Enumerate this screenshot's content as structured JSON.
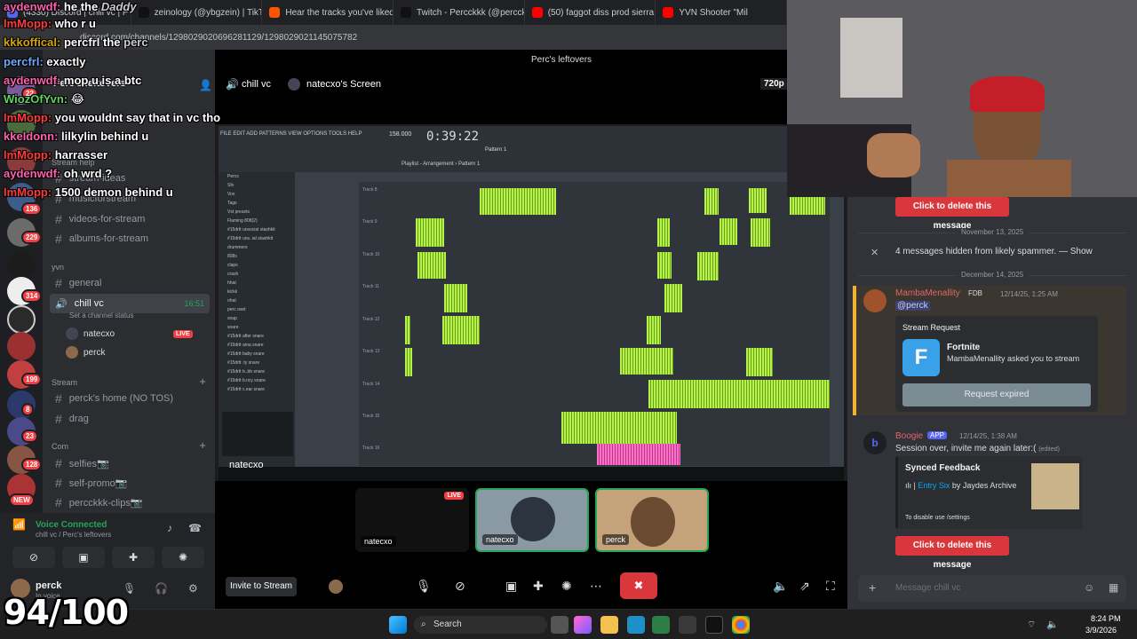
{
  "browser": {
    "tabs": [
      {
        "label": "(4330) Discord | chill vc | P",
        "color": "#5865f2"
      },
      {
        "label": "zeinology (@ybgzein) | TikTok",
        "color": "#111111"
      },
      {
        "label": "Hear the tracks you've liked: on",
        "color": "#ff5500"
      },
      {
        "label": "Twitch - Percckkk (@percckkkp",
        "color": "#111111"
      },
      {
        "label": "(50) faggot diss prod sierra by",
        "color": "#ff0000"
      },
      {
        "label": "YVN Shooter \"Mil",
        "color": "#ff0000"
      }
    ],
    "url": "discord.com/channels/1298029020696281129/1298029021145075782"
  },
  "discord": {
    "server_name": "Perc's leftovers",
    "stream_window_title": "Perc's leftovers",
    "channel_header": {
      "voice_channel": "chill vc",
      "streamer": "natecxo's Screen",
      "quality": "720p"
    },
    "categories": [
      {
        "name": "Stream help"
      },
      {
        "name": "yvn"
      },
      {
        "name": "Stream"
      },
      {
        "name": "Com"
      }
    ],
    "channels": {
      "top": [
        "stream-ideas",
        "musicforstream",
        "videos-for-stream",
        "albums-for-stream"
      ],
      "yvn": [
        "general"
      ],
      "voice": {
        "name": "chill vc",
        "time": "16:51",
        "status": "Set a channel status",
        "users": [
          {
            "name": "natecxo",
            "live": "LIVE"
          },
          {
            "name": "perck",
            "live": ""
          }
        ]
      },
      "stream": [
        "perck's home (NO TOS)",
        "drag"
      ],
      "com": [
        "selfies📷",
        "self-promo📷",
        "percckkk-clips📷"
      ]
    },
    "server_badges": [
      "22",
      "136",
      "229",
      "314",
      "199",
      "8",
      "23",
      "128",
      "NEW"
    ],
    "voice_panel": {
      "status": "Voice Connected",
      "location": "chill vc / Perc's leftovers"
    },
    "user": {
      "name": "perck",
      "status": "In voice"
    },
    "thumbs": [
      {
        "name": "natecxo",
        "live": "LIVE"
      },
      {
        "name": "natecxo"
      },
      {
        "name": "perck"
      }
    ],
    "stage_label": "natecxo",
    "invite_button": "Invite to Stream"
  },
  "daw": {
    "menu": "FILE  EDIT  ADD  PATTERNS  VIEW  OPTIONS  TOOLS  HELP",
    "time": "0:39:22",
    "tempo": "158.000",
    "pattern": "Pattern 1",
    "playlist_title": "Playlist - Arrangement › Pattern 1",
    "browser_items": [
      "Percs",
      "Sfx",
      "Vox",
      "Tags",
      "Vst presets",
      "Flaming 808(2)",
      "#15drtt unsocial stashkit",
      "#15drtt uns..ial stashkit",
      "drummers",
      "808s",
      "claps",
      "crash",
      "hhat",
      "kickk",
      "ohat",
      "perc oset",
      "snap",
      "snare",
      "#15drtt after snare",
      "#15drtt ama snare",
      "#15drtt baby snare",
      "#15drtt .ty snare",
      "#15drtt b..bb snare",
      "#15drtt b.ncy snare",
      "#15drtt c.ear snare"
    ],
    "tracks": [
      "Track 8",
      "Track 9",
      "Track 10",
      "Track 11",
      "Track 12",
      "Track 13",
      "Track 14",
      "Track 15",
      "Track 16"
    ]
  },
  "chat": {
    "delete_label": "Click to delete this message",
    "date1": "November 13, 2025",
    "hidden": "4 messages hidden from likely spammer. —",
    "show": "Show",
    "date2": "December 14, 2025",
    "msg1": {
      "author": "MambaMenallity",
      "tag": "FDB",
      "time": "12/14/25, 1:25 AM",
      "mention": "@perck"
    },
    "embed": {
      "title": "Stream Request",
      "game": "Fortnite",
      "desc": "MambaMenallity asked you to stream",
      "button": "Request expired"
    },
    "msg2": {
      "author": "Boogie",
      "tag": "APP",
      "time": "12/14/25, 1:38 AM",
      "text": "Session over, invite me again later:(",
      "edited": "(edited)"
    },
    "embed2": {
      "title": "Synced Feedback",
      "track": "Entry Six",
      "by": "by Jaydes Archive",
      "hint": "To disable use /settings"
    },
    "input_placeholder": "Message chill vc"
  },
  "overlay_chat": [
    {
      "name": "aydenwdf:",
      "text": "he the",
      "extra": "Daddy"
    },
    {
      "name": "lmMopp:",
      "text": "who r u"
    },
    {
      "name": "kkkoffical:",
      "text": "percfrl the",
      "extra": "perc"
    },
    {
      "name": "percfrl:",
      "text": "exactly"
    },
    {
      "name": "aydenwdf:",
      "text": "mop u is a btc"
    },
    {
      "name": "WiozOfYvn:",
      "text": "😂"
    },
    {
      "name": "lmMopp:",
      "text": "you wouldnt say that in vc tho"
    },
    {
      "name": "kkeldonn:",
      "text": "lilkylin behind u"
    },
    {
      "name": "lmMopp:",
      "text": "harrasser"
    },
    {
      "name": "aydenwdf:",
      "text": "oh wrd ?"
    },
    {
      "name": "lmMopp:",
      "text": "1500 demon behind u"
    }
  ],
  "score": "94/100",
  "taskbar": {
    "search": "Search",
    "time": "8:24 PM",
    "date": "3/9/2026"
  }
}
